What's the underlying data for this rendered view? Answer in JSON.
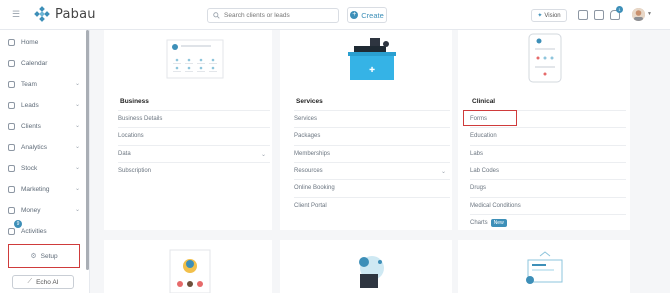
{
  "app": {
    "name": "Pabau",
    "brand_color": "#3d8fb8"
  },
  "header": {
    "search_placeholder": "Search clients or leads",
    "create_label": "Create",
    "vision_label": "Vision",
    "notification_count": "1"
  },
  "sidebar": {
    "items": [
      {
        "label": "Home",
        "icon": "home-icon"
      },
      {
        "label": "Calendar",
        "icon": "calendar-icon"
      },
      {
        "label": "Team",
        "icon": "team-icon"
      },
      {
        "label": "Leads",
        "icon": "leads-icon"
      },
      {
        "label": "Clients",
        "icon": "clients-icon"
      },
      {
        "label": "Analytics",
        "icon": "analytics-icon"
      },
      {
        "label": "Stock",
        "icon": "stock-icon"
      },
      {
        "label": "Marketing",
        "icon": "marketing-icon"
      },
      {
        "label": "Money",
        "icon": "money-icon"
      },
      {
        "label": "Activities",
        "icon": "activities-icon"
      }
    ],
    "activities_badge": "9",
    "setup_label": "Setup",
    "echo_label": "Echo AI"
  },
  "sections": {
    "business": {
      "title": "Business",
      "items": [
        "Business Details",
        "Locations",
        "Data",
        "Subscription"
      ]
    },
    "services": {
      "title": "Services",
      "items": [
        "Services",
        "Packages",
        "Memberships",
        "Resources",
        "Online Booking",
        "Client Portal"
      ]
    },
    "clinical": {
      "title": "Clinical",
      "items": [
        "Forms",
        "Education",
        "Labs",
        "Lab Codes",
        "Drugs",
        "Medical Conditions",
        "Charts"
      ],
      "new_badge": "New"
    }
  }
}
